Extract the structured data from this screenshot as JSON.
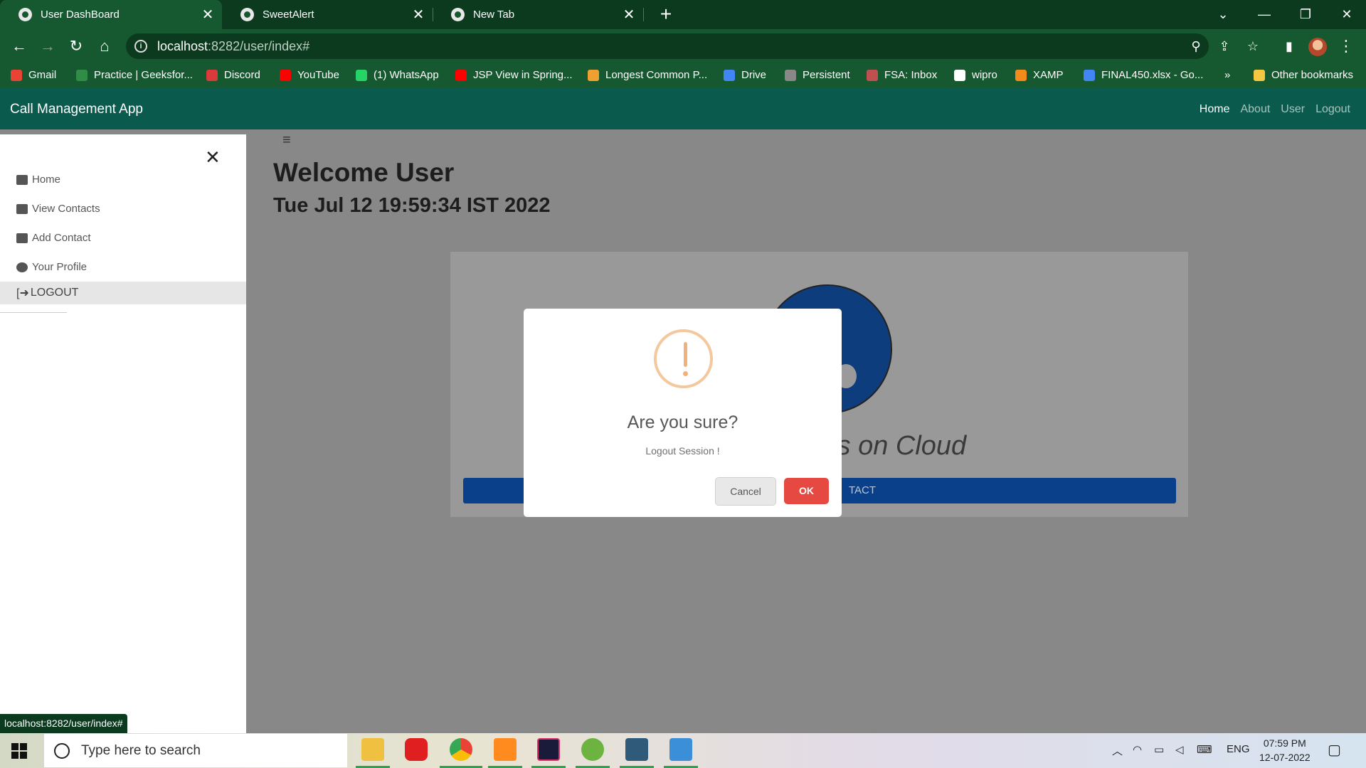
{
  "browser": {
    "tabs": [
      {
        "title": "User DashBoard",
        "active": true
      },
      {
        "title": "SweetAlert",
        "active": false
      },
      {
        "title": "New Tab",
        "active": false
      }
    ],
    "url_host": "localhost",
    "url_path": ":8282/user/index#",
    "bookmarks": [
      {
        "label": "Gmail",
        "color": "#ea4335"
      },
      {
        "label": "Practice | Geeksfor...",
        "color": "#2f8d46"
      },
      {
        "label": "Discord",
        "color": "#d93a3a"
      },
      {
        "label": "YouTube",
        "color": "#ff0000"
      },
      {
        "label": "(1) WhatsApp",
        "color": "#25d366"
      },
      {
        "label": "JSP View in Spring...",
        "color": "#ff0000"
      },
      {
        "label": "Longest Common P...",
        "color": "#f0a030"
      },
      {
        "label": "Drive",
        "color": "#4285f4"
      },
      {
        "label": "Persistent",
        "color": "#888888"
      },
      {
        "label": "FSA: Inbox",
        "color": "#c05050"
      },
      {
        "label": "wipro",
        "color": "#ffffff"
      },
      {
        "label": "XAMP",
        "color": "#f48a1a"
      },
      {
        "label": "FINAL450.xlsx - Go...",
        "color": "#4285f4"
      }
    ],
    "bookmarks_overflow": "»",
    "other_bookmarks": "Other bookmarks",
    "status_url": "localhost:8282/user/index#"
  },
  "app": {
    "brand": "Call Management App",
    "nav": [
      "Home",
      "About",
      "User",
      "Logout"
    ],
    "sidebar": {
      "items": [
        "Home",
        "View Contacts",
        "Add Contact",
        "Your Profile"
      ],
      "logout": "LOGOUT"
    },
    "welcome": "Welcome User",
    "datetime": "Tue Jul 12 19:59:34 IST 2022",
    "tagline": "ontacts on Cloud",
    "card_button": "TACT"
  },
  "modal": {
    "title": "Are you sure?",
    "text": "Logout Session !",
    "cancel": "Cancel",
    "ok": "OK"
  },
  "taskbar": {
    "search_placeholder": "Type here to search",
    "language": "ENG",
    "time": "07:59 PM",
    "date": "12-07-2022"
  },
  "colors": {
    "chrome_dark": "#0b3a1f",
    "chrome": "#16582f",
    "app_nav": "#0b5a4e",
    "ok_button": "#e64942",
    "warning": "#f0b27c"
  }
}
